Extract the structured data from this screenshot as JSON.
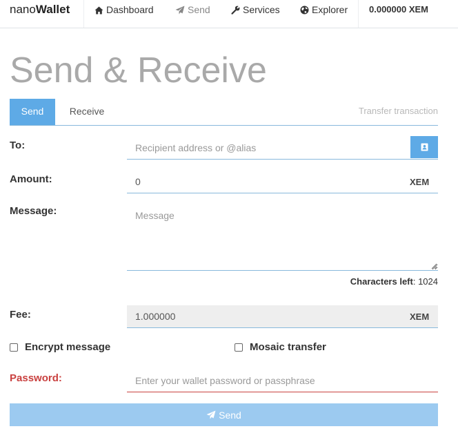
{
  "navbar": {
    "brand_prefix": "nano",
    "brand_bold": "Wallet",
    "items": [
      {
        "label": "Dashboard",
        "icon": "home-icon"
      },
      {
        "label": "Send",
        "icon": "paper-plane-icon",
        "active": true
      },
      {
        "label": "Services",
        "icon": "wrench-icon"
      },
      {
        "label": "Explorer",
        "icon": "globe-icon"
      }
    ],
    "balance": "0.000000 XEM"
  },
  "page": {
    "title": "Send & Receive"
  },
  "tabs": {
    "send": "Send",
    "receive": "Receive",
    "caption": "Transfer transaction"
  },
  "form": {
    "to_label": "To:",
    "to_placeholder": "Recipient address or @alias",
    "amount_label": "Amount:",
    "amount_value": "0",
    "amount_unit": "XEM",
    "message_label": "Message:",
    "message_placeholder": "Message",
    "chars_left_label": "Characters left",
    "chars_left_value": ": 1024",
    "fee_label": "Fee:",
    "fee_value": "1.000000",
    "fee_unit": "XEM",
    "encrypt_label": "Encrypt message",
    "mosaic_label": "Mosaic transfer",
    "password_label": "Password:",
    "password_placeholder": "Enter your wallet password or passphrase",
    "send_button": "Send"
  },
  "colors": {
    "accent": "#5eaae6",
    "send_button_bg": "#9ccaf0",
    "danger": "#c9403f",
    "title_gray": "#a9a9a9"
  }
}
